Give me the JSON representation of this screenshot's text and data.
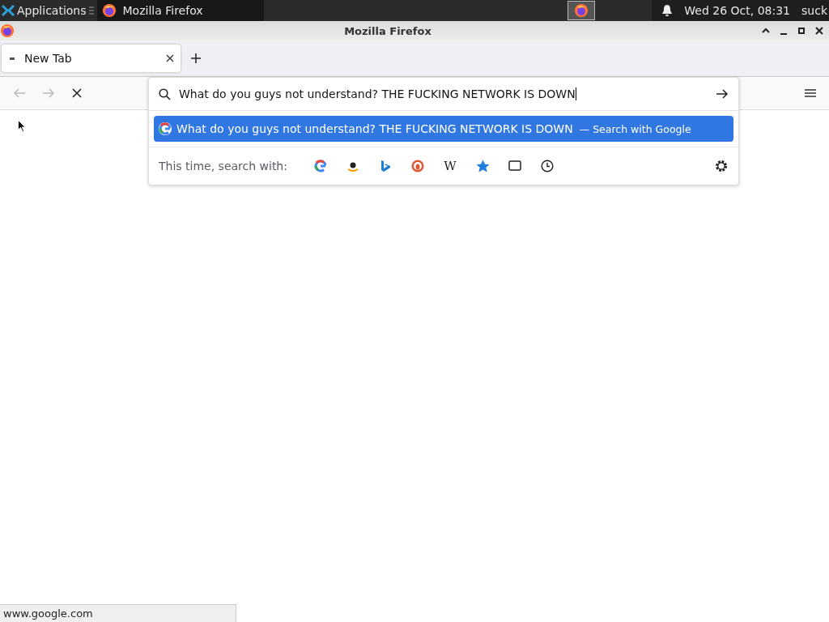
{
  "top_panel": {
    "menu": "Applications",
    "task": "Mozilla Firefox",
    "clock": "Wed 26 Oct, 08:31",
    "user": "suck"
  },
  "window": {
    "title": "Mozilla Firefox"
  },
  "tabs": [
    {
      "label": "New Tab",
      "selected": true
    }
  ],
  "nav": {
    "back_disabled": true,
    "forward_disabled": true
  },
  "url_bar": {
    "value": "What do you guys not understand? THE FUCKING NETWORK IS DOWN"
  },
  "suggestions": [
    {
      "text": "What do you guys not understand? THE FUCKING NETWORK IS DOWN",
      "action": "— Search with Google",
      "selected": true
    }
  ],
  "engines_label": "This time, search with:",
  "engines": [
    {
      "kind": "google"
    },
    {
      "kind": "amazon"
    },
    {
      "kind": "bing"
    },
    {
      "kind": "duck"
    },
    {
      "kind": "wiki",
      "text": "W"
    },
    {
      "kind": "bookmarks"
    },
    {
      "kind": "tabs"
    },
    {
      "kind": "history"
    }
  ],
  "status": "www.google.com"
}
